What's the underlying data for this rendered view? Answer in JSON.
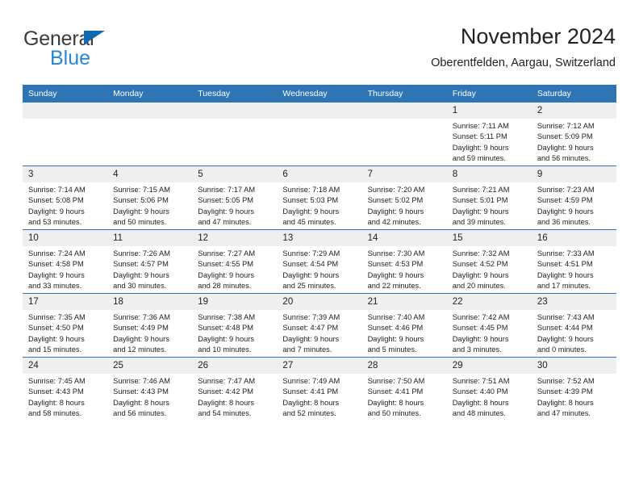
{
  "brand": {
    "name_top": "General",
    "name_bottom": "Blue",
    "accent_color": "#2786d6",
    "triangle_color": "#1268b3"
  },
  "header": {
    "title": "November 2024",
    "subtitle": "Oberentfelden, Aargau, Switzerland"
  },
  "theme": {
    "header_row_bg": "#2e75b6",
    "daynum_bg": "#efefef",
    "text": "#222222"
  },
  "weekday_headers": [
    "Sunday",
    "Monday",
    "Tuesday",
    "Wednesday",
    "Thursday",
    "Friday",
    "Saturday"
  ],
  "weeks": [
    [
      {
        "day": "",
        "lines": []
      },
      {
        "day": "",
        "lines": []
      },
      {
        "day": "",
        "lines": []
      },
      {
        "day": "",
        "lines": []
      },
      {
        "day": "",
        "lines": []
      },
      {
        "day": "1",
        "lines": [
          "Sunrise: 7:11 AM",
          "Sunset: 5:11 PM",
          "Daylight: 9 hours",
          "and 59 minutes."
        ]
      },
      {
        "day": "2",
        "lines": [
          "Sunrise: 7:12 AM",
          "Sunset: 5:09 PM",
          "Daylight: 9 hours",
          "and 56 minutes."
        ]
      }
    ],
    [
      {
        "day": "3",
        "lines": [
          "Sunrise: 7:14 AM",
          "Sunset: 5:08 PM",
          "Daylight: 9 hours",
          "and 53 minutes."
        ]
      },
      {
        "day": "4",
        "lines": [
          "Sunrise: 7:15 AM",
          "Sunset: 5:06 PM",
          "Daylight: 9 hours",
          "and 50 minutes."
        ]
      },
      {
        "day": "5",
        "lines": [
          "Sunrise: 7:17 AM",
          "Sunset: 5:05 PM",
          "Daylight: 9 hours",
          "and 47 minutes."
        ]
      },
      {
        "day": "6",
        "lines": [
          "Sunrise: 7:18 AM",
          "Sunset: 5:03 PM",
          "Daylight: 9 hours",
          "and 45 minutes."
        ]
      },
      {
        "day": "7",
        "lines": [
          "Sunrise: 7:20 AM",
          "Sunset: 5:02 PM",
          "Daylight: 9 hours",
          "and 42 minutes."
        ]
      },
      {
        "day": "8",
        "lines": [
          "Sunrise: 7:21 AM",
          "Sunset: 5:01 PM",
          "Daylight: 9 hours",
          "and 39 minutes."
        ]
      },
      {
        "day": "9",
        "lines": [
          "Sunrise: 7:23 AM",
          "Sunset: 4:59 PM",
          "Daylight: 9 hours",
          "and 36 minutes."
        ]
      }
    ],
    [
      {
        "day": "10",
        "lines": [
          "Sunrise: 7:24 AM",
          "Sunset: 4:58 PM",
          "Daylight: 9 hours",
          "and 33 minutes."
        ]
      },
      {
        "day": "11",
        "lines": [
          "Sunrise: 7:26 AM",
          "Sunset: 4:57 PM",
          "Daylight: 9 hours",
          "and 30 minutes."
        ]
      },
      {
        "day": "12",
        "lines": [
          "Sunrise: 7:27 AM",
          "Sunset: 4:55 PM",
          "Daylight: 9 hours",
          "and 28 minutes."
        ]
      },
      {
        "day": "13",
        "lines": [
          "Sunrise: 7:29 AM",
          "Sunset: 4:54 PM",
          "Daylight: 9 hours",
          "and 25 minutes."
        ]
      },
      {
        "day": "14",
        "lines": [
          "Sunrise: 7:30 AM",
          "Sunset: 4:53 PM",
          "Daylight: 9 hours",
          "and 22 minutes."
        ]
      },
      {
        "day": "15",
        "lines": [
          "Sunrise: 7:32 AM",
          "Sunset: 4:52 PM",
          "Daylight: 9 hours",
          "and 20 minutes."
        ]
      },
      {
        "day": "16",
        "lines": [
          "Sunrise: 7:33 AM",
          "Sunset: 4:51 PM",
          "Daylight: 9 hours",
          "and 17 minutes."
        ]
      }
    ],
    [
      {
        "day": "17",
        "lines": [
          "Sunrise: 7:35 AM",
          "Sunset: 4:50 PM",
          "Daylight: 9 hours",
          "and 15 minutes."
        ]
      },
      {
        "day": "18",
        "lines": [
          "Sunrise: 7:36 AM",
          "Sunset: 4:49 PM",
          "Daylight: 9 hours",
          "and 12 minutes."
        ]
      },
      {
        "day": "19",
        "lines": [
          "Sunrise: 7:38 AM",
          "Sunset: 4:48 PM",
          "Daylight: 9 hours",
          "and 10 minutes."
        ]
      },
      {
        "day": "20",
        "lines": [
          "Sunrise: 7:39 AM",
          "Sunset: 4:47 PM",
          "Daylight: 9 hours",
          "and 7 minutes."
        ]
      },
      {
        "day": "21",
        "lines": [
          "Sunrise: 7:40 AM",
          "Sunset: 4:46 PM",
          "Daylight: 9 hours",
          "and 5 minutes."
        ]
      },
      {
        "day": "22",
        "lines": [
          "Sunrise: 7:42 AM",
          "Sunset: 4:45 PM",
          "Daylight: 9 hours",
          "and 3 minutes."
        ]
      },
      {
        "day": "23",
        "lines": [
          "Sunrise: 7:43 AM",
          "Sunset: 4:44 PM",
          "Daylight: 9 hours",
          "and 0 minutes."
        ]
      }
    ],
    [
      {
        "day": "24",
        "lines": [
          "Sunrise: 7:45 AM",
          "Sunset: 4:43 PM",
          "Daylight: 8 hours",
          "and 58 minutes."
        ]
      },
      {
        "day": "25",
        "lines": [
          "Sunrise: 7:46 AM",
          "Sunset: 4:43 PM",
          "Daylight: 8 hours",
          "and 56 minutes."
        ]
      },
      {
        "day": "26",
        "lines": [
          "Sunrise: 7:47 AM",
          "Sunset: 4:42 PM",
          "Daylight: 8 hours",
          "and 54 minutes."
        ]
      },
      {
        "day": "27",
        "lines": [
          "Sunrise: 7:49 AM",
          "Sunset: 4:41 PM",
          "Daylight: 8 hours",
          "and 52 minutes."
        ]
      },
      {
        "day": "28",
        "lines": [
          "Sunrise: 7:50 AM",
          "Sunset: 4:41 PM",
          "Daylight: 8 hours",
          "and 50 minutes."
        ]
      },
      {
        "day": "29",
        "lines": [
          "Sunrise: 7:51 AM",
          "Sunset: 4:40 PM",
          "Daylight: 8 hours",
          "and 48 minutes."
        ]
      },
      {
        "day": "30",
        "lines": [
          "Sunrise: 7:52 AM",
          "Sunset: 4:39 PM",
          "Daylight: 8 hours",
          "and 47 minutes."
        ]
      }
    ]
  ]
}
